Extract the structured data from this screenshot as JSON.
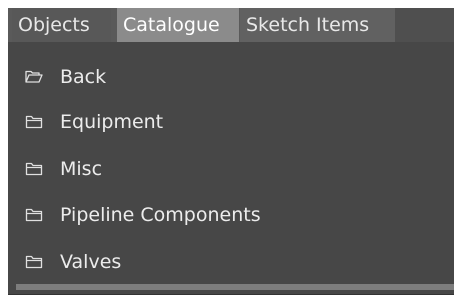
{
  "tabs": [
    {
      "label": "Objects"
    },
    {
      "label": "Catalogue"
    },
    {
      "label": "Sketch Items"
    }
  ],
  "active_tab": "Catalogue",
  "items": [
    {
      "label": "Back",
      "icon": "folder-open-icon"
    },
    {
      "label": "Equipment",
      "icon": "folder-icon"
    },
    {
      "label": "Misc",
      "icon": "folder-icon"
    },
    {
      "label": "Pipeline Components",
      "icon": "folder-icon"
    },
    {
      "label": "Valves",
      "icon": "folder-icon"
    }
  ],
  "colors": {
    "panel_background": "#474747",
    "active_tab": "#8b8b8b",
    "text": "#ececec"
  }
}
